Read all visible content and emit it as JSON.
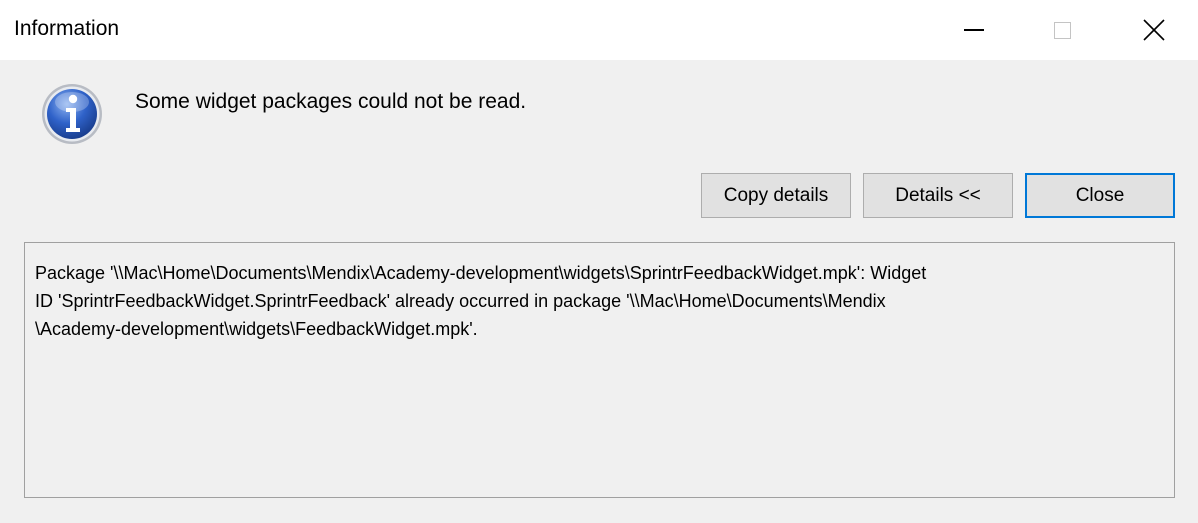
{
  "window": {
    "title": "Information"
  },
  "dialog": {
    "message": "Some widget packages could not be read.",
    "icon": "info-icon"
  },
  "buttons": {
    "copy_label": "Copy details",
    "details_label": "Details <<",
    "close_label": "Close"
  },
  "details": {
    "text": "Package '\\\\Mac\\Home\\Documents\\Mendix\\Academy-development\\widgets\\SprintrFeedbackWidget.mpk': Widget\nID 'SprintrFeedbackWidget.SprintrFeedback' already occurred in package '\\\\Mac\\Home\\Documents\\Mendix\n\\Academy-development\\widgets\\FeedbackWidget.mpk'."
  },
  "colors": {
    "accent": "#0078d7",
    "background": "#f0f0f0",
    "titlebar": "#ffffff"
  }
}
